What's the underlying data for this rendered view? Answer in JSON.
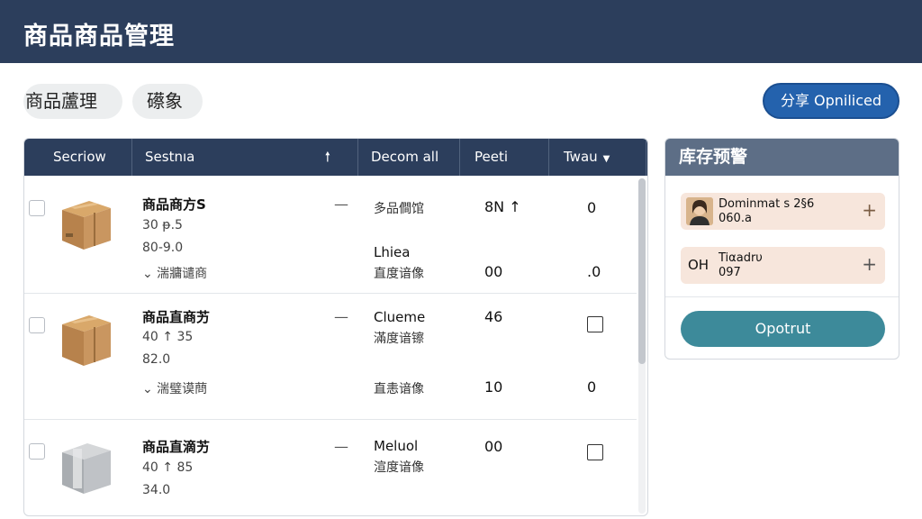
{
  "app": {
    "title": "商品商品管理"
  },
  "chips": [
    "商品蘆理",
    "礤象"
  ],
  "share_button": "分享 Opniliced",
  "table": {
    "headers": [
      "Secriow",
      "Sestnıa",
      "Decom all",
      "Peeti",
      "Twau"
    ],
    "rows": [
      {
        "name": "商品商方S",
        "line1": "30 ᵽ.5",
        "line2": "80-9.0",
        "category": "⌄ 湍牅谴商",
        "dash": "—",
        "c3a": "多品僴馆",
        "c3b_bold": "Lhiea",
        "c3b": "直度谙像",
        "c4a": "8N ↑",
        "c4b": "00",
        "c5a": "0",
        "c5b": ".0",
        "thumb": "cardboard-box"
      },
      {
        "name": "商品直商艻",
        "line1": "40 ↑ 35",
        "line2": "82.0",
        "category": "⌄ 湍璧谟蔄",
        "dash": "—",
        "c3a_bold": "Clueme",
        "c3a": "滿度谙镲",
        "c3b": "直恚谙像",
        "c4a": "46",
        "c4b": "10",
        "c5b": "0",
        "thumb": "cardboard-box"
      },
      {
        "name": "商品直滴艻",
        "line1": "40 ↑ 85",
        "line2": "34.0",
        "dash": "—",
        "c3a_bold": "Meluol",
        "c3a": "渲度谙像",
        "c4a": "00",
        "thumb": "gray-box"
      }
    ]
  },
  "panel": {
    "title": "库存预警",
    "alerts": [
      {
        "line1": "Dominmat s 2§6",
        "line2": "060.a",
        "icon": "person-avatar"
      },
      {
        "badge": "OH",
        "line1": "Tiαadrυ",
        "line2": "097"
      }
    ],
    "button": "Opotrut"
  },
  "colors": {
    "header": "#2c3e5c",
    "accent_blue": "#2462ad",
    "teal": "#3d8a9a",
    "alert_bg": "#f7e6dc"
  }
}
